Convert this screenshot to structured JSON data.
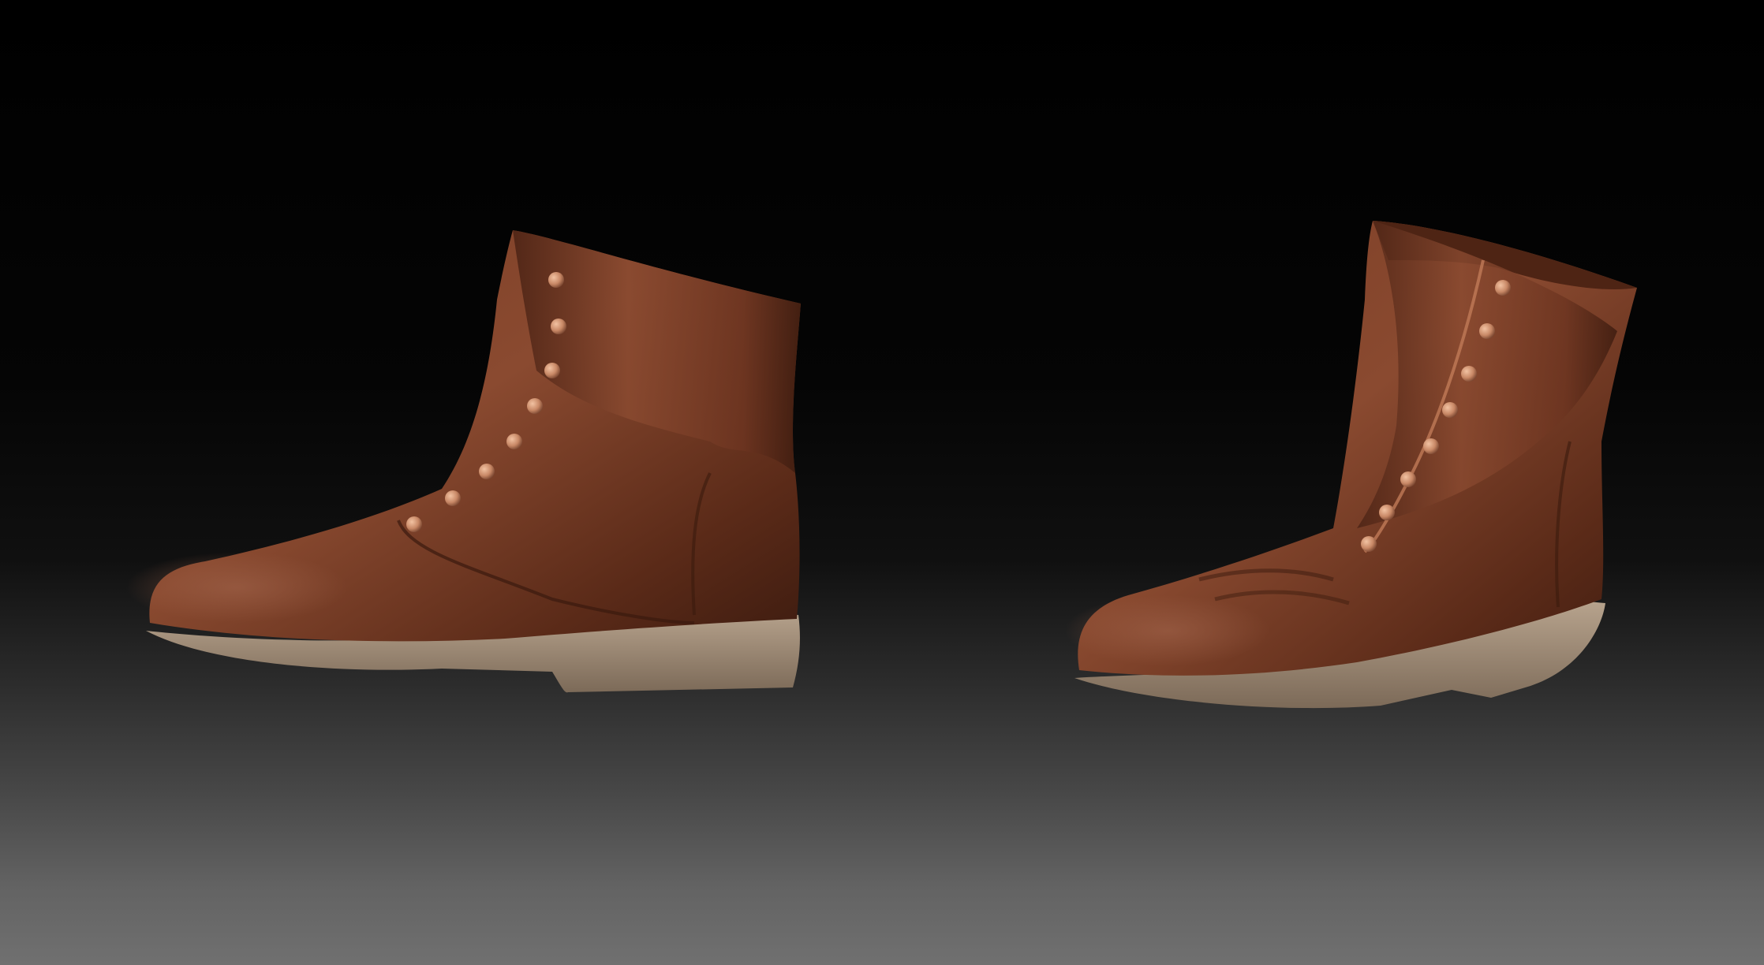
{
  "scene": {
    "background_top": "#000000",
    "background_bottom": "#707070",
    "leather_color": "#6a3420",
    "leather_highlight": "#9a5a3c",
    "sole_color": "#a08c78",
    "button_color": "#d69a78"
  },
  "boots": [
    {
      "name": "left-boot",
      "button_count": 8
    },
    {
      "name": "right-boot",
      "button_count": 8
    }
  ]
}
